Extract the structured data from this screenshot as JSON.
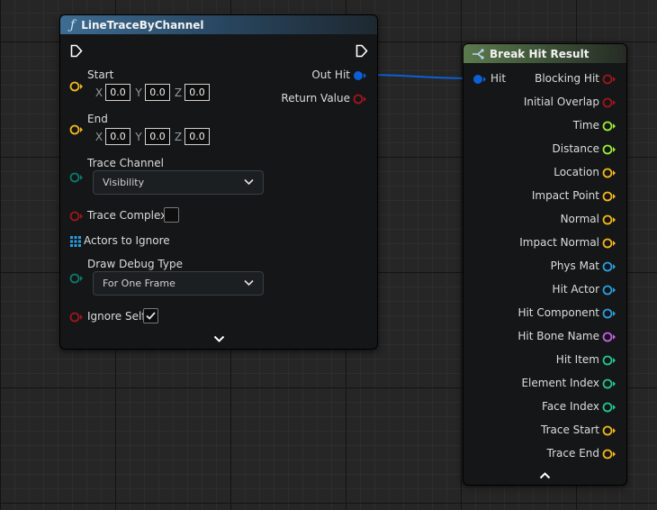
{
  "trace_node": {
    "title": "LineTraceByChannel",
    "function_icon": "function-icon",
    "inputs": {
      "start": {
        "label": "Start",
        "x_label": "X",
        "y_label": "Y",
        "z_label": "Z",
        "x": "0.0",
        "y": "0.0",
        "z": "0.0"
      },
      "end": {
        "label": "End",
        "x_label": "X",
        "y_label": "Y",
        "z_label": "Z",
        "x": "0.0",
        "y": "0.0",
        "z": "0.0"
      },
      "trace_channel": {
        "label": "Trace Channel",
        "value": "Visibility"
      },
      "trace_complex": {
        "label": "Trace Complex",
        "checked": false
      },
      "actors_to_ignore": {
        "label": "Actors to Ignore"
      },
      "draw_debug_type": {
        "label": "Draw Debug Type",
        "value": "For One Frame"
      },
      "ignore_self": {
        "label": "Ignore Self",
        "checked": true
      }
    },
    "outputs": {
      "out_hit": "Out Hit",
      "return_value": "Return Value"
    }
  },
  "break_node": {
    "title": "Break Hit Result",
    "input_label": "Hit",
    "outputs": [
      {
        "label": "Blocking Hit",
        "color": "#a0161b",
        "pin": "circle"
      },
      {
        "label": "Initial Overlap",
        "color": "#a0161b",
        "pin": "circle"
      },
      {
        "label": "Time",
        "color": "#9bec37",
        "pin": "circle"
      },
      {
        "label": "Distance",
        "color": "#9bec37",
        "pin": "circle"
      },
      {
        "label": "Location",
        "color": "#f4b71c",
        "pin": "circle"
      },
      {
        "label": "Impact Point",
        "color": "#f4b71c",
        "pin": "circle"
      },
      {
        "label": "Normal",
        "color": "#f4b71c",
        "pin": "circle"
      },
      {
        "label": "Impact Normal",
        "color": "#f4b71c",
        "pin": "circle"
      },
      {
        "label": "Phys Mat",
        "color": "#2a9fe0",
        "pin": "circle"
      },
      {
        "label": "Hit Actor",
        "color": "#2a9fe0",
        "pin": "circle"
      },
      {
        "label": "Hit Component",
        "color": "#2a9fe0",
        "pin": "circle"
      },
      {
        "label": "Hit Bone Name",
        "color": "#c95ee6",
        "pin": "circle"
      },
      {
        "label": "Hit Item",
        "color": "#21c792",
        "pin": "circle"
      },
      {
        "label": "Element Index",
        "color": "#21c792",
        "pin": "circle"
      },
      {
        "label": "Face Index",
        "color": "#21c792",
        "pin": "circle"
      },
      {
        "label": "Trace Start",
        "color": "#f4b71c",
        "pin": "circle"
      },
      {
        "label": "Trace End",
        "color": "#f4b71c",
        "pin": "circle"
      }
    ]
  },
  "colors": {
    "vector": "#f4b71c",
    "bool": "#a0161b",
    "enum": "#0b6e62",
    "struct": "#0d5fd6",
    "object_array": "#2a9fe0",
    "wire": "#0d5fd6"
  }
}
